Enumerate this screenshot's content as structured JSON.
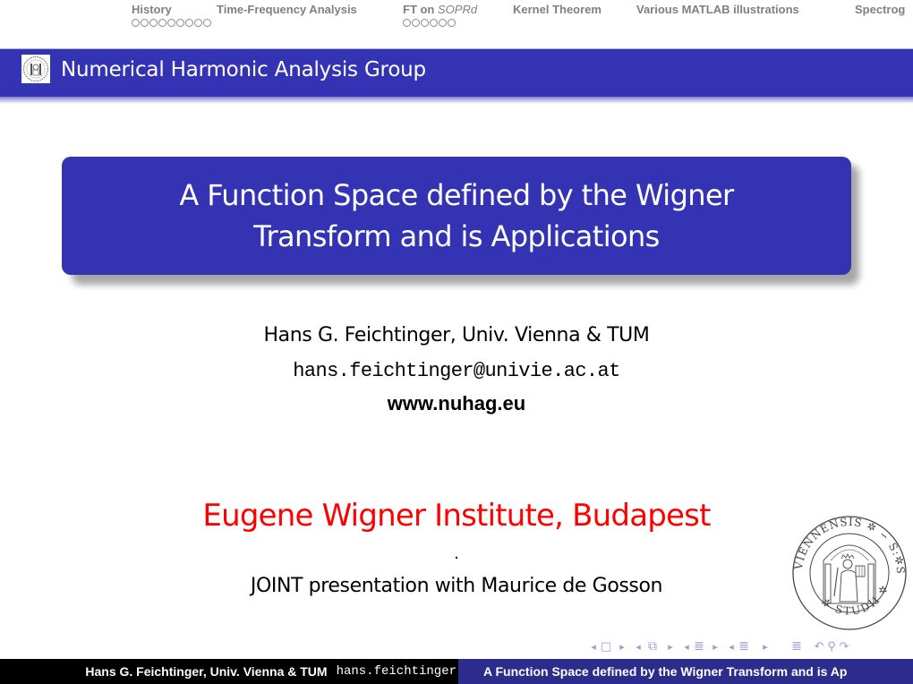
{
  "nav": {
    "sections": [
      {
        "label": "History",
        "dots": 9
      },
      {
        "label": "Time-Frequency Analysis",
        "dots": 0
      },
      {
        "label_prefix": "FT on ",
        "label_italic": "SOPRd",
        "dots": 6
      },
      {
        "label": "Kernel Theorem",
        "dots": 0
      },
      {
        "label": "Various MATLAB illustrations",
        "dots": 0
      },
      {
        "label": "Spectrog",
        "dots": 0
      }
    ]
  },
  "header": {
    "title": "Numerical Harmonic Analysis Group",
    "logo_icon": "university-seal-icon",
    "bar_color": "#3333b3"
  },
  "title_block": {
    "line1": "A Function Space defined by the Wigner",
    "line2": "Transform and is Applications"
  },
  "author": {
    "name": "Hans G. Feichtinger, Univ. Vienna & TUM",
    "email": "hans.feichtinger@univie.ac.at",
    "website": "www.nuhag.eu"
  },
  "institute": {
    "name": "Eugene Wigner Institute, Budapest",
    "separator": ".",
    "joint": "JOINT presentation with Maurice de Gosson",
    "color": "#ff0000"
  },
  "seal": {
    "icon": "university-of-vienna-seal-icon",
    "text_left": "VIENNENSIS",
    "text_right": "SAPIENTIAE",
    "text_bottom": "STUDII",
    "text_top": "S"
  },
  "nav_symbols": [
    {
      "name": "prev-frame",
      "glyph": "◂"
    },
    {
      "name": "frame",
      "glyph": "□"
    },
    {
      "name": "next-frame",
      "glyph": "▸"
    },
    {
      "name": "prev-slide",
      "glyph": "◂"
    },
    {
      "name": "slide",
      "glyph": "⧉"
    },
    {
      "name": "next-slide",
      "glyph": "▸"
    },
    {
      "name": "prev-subsection",
      "glyph": "◂"
    },
    {
      "name": "subsection",
      "glyph": "≣"
    },
    {
      "name": "next-subsection",
      "glyph": "▸"
    },
    {
      "name": "prev-section",
      "glyph": "◂"
    },
    {
      "name": "section",
      "glyph": "≣"
    },
    {
      "name": "next-section",
      "glyph": "▸"
    },
    {
      "name": "document",
      "glyph": "≣"
    },
    {
      "name": "undo",
      "glyph": "↶"
    },
    {
      "name": "search",
      "glyph": "⚲"
    },
    {
      "name": "redo",
      "glyph": "↷"
    }
  ],
  "footer": {
    "author": "Hans G. Feichtinger, Univ. Vienna & TUM",
    "email": "hans.feichtinger",
    "title": "A Function Space defined by the Wigner Transform and is Ap"
  }
}
